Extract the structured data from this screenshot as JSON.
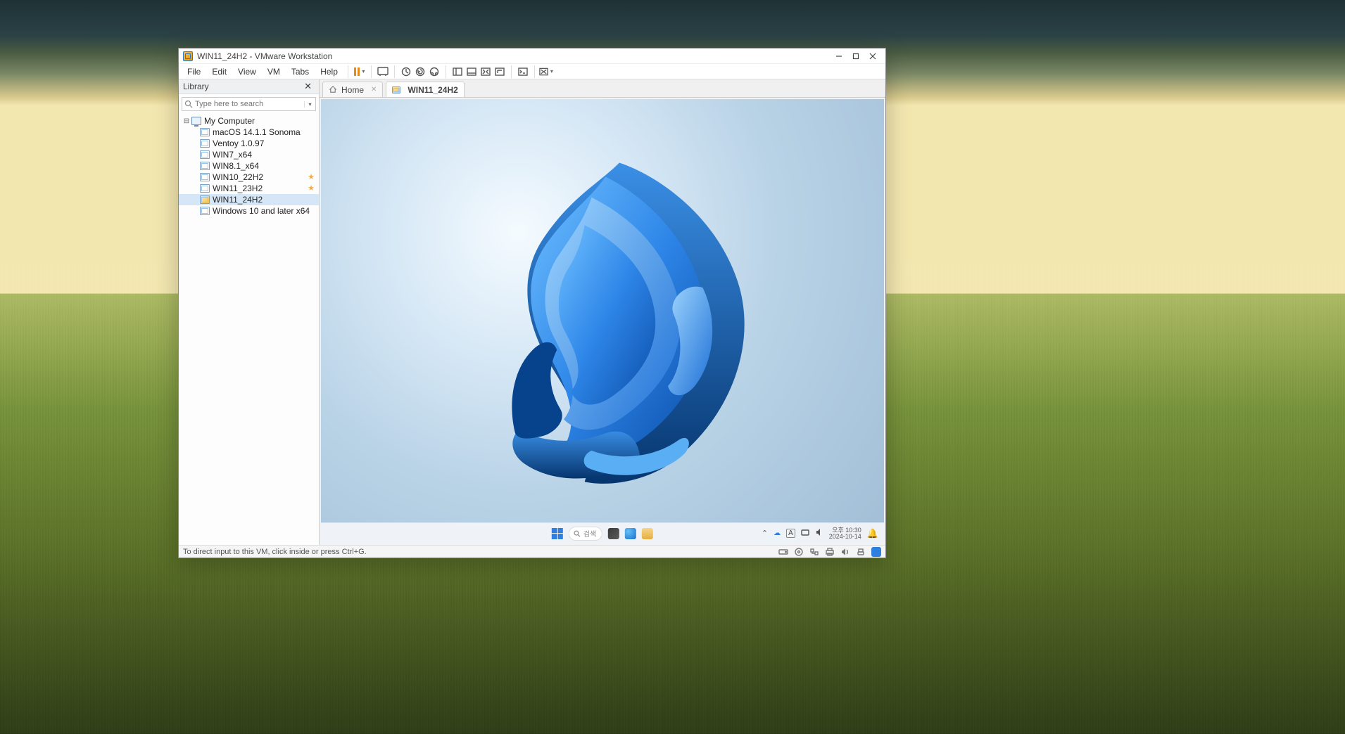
{
  "window": {
    "title": "WIN11_24H2 - VMware Workstation"
  },
  "menu": {
    "file": "File",
    "edit": "Edit",
    "view": "View",
    "vm": "VM",
    "tabs": "Tabs",
    "help": "Help"
  },
  "library": {
    "title": "Library",
    "search_placeholder": "Type here to search",
    "root": "My Computer",
    "items": [
      {
        "name": "macOS 14.1.1 Sonoma",
        "fav": false,
        "on": false
      },
      {
        "name": "Ventoy 1.0.97",
        "fav": false,
        "on": false
      },
      {
        "name": "WIN7_x64",
        "fav": false,
        "on": false
      },
      {
        "name": "WIN8.1_x64",
        "fav": false,
        "on": false
      },
      {
        "name": "WIN10_22H2",
        "fav": true,
        "on": false
      },
      {
        "name": "WIN11_23H2",
        "fav": true,
        "on": false
      },
      {
        "name": "WIN11_24H2",
        "fav": false,
        "on": true,
        "selected": true
      },
      {
        "name": "Windows 10 and later x64",
        "fav": false,
        "on": false
      }
    ]
  },
  "tabs": {
    "home": "Home",
    "active": "WIN11_24H2"
  },
  "guest_taskbar": {
    "search": "검색",
    "time": "오후 10:30",
    "date": "2024-10-14"
  },
  "statusbar": {
    "hint": "To direct input to this VM, click inside or press Ctrl+G."
  }
}
